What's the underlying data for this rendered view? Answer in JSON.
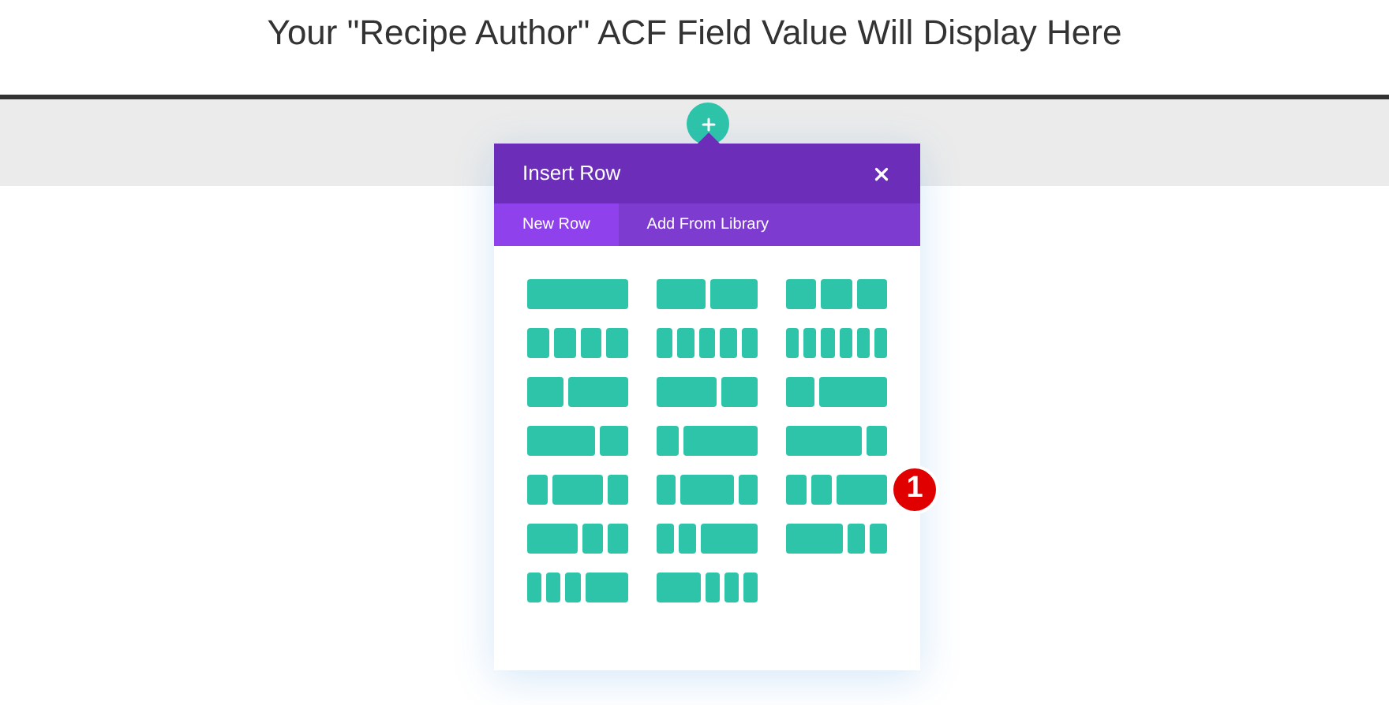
{
  "heading": "Your \"Recipe Author\" ACF Field Value Will Display Here",
  "dialog": {
    "title": "Insert Row",
    "tabs": [
      {
        "label": "New Row",
        "selected": true
      },
      {
        "label": "Add From Library",
        "selected": false
      }
    ]
  },
  "callout": {
    "label": "1"
  }
}
